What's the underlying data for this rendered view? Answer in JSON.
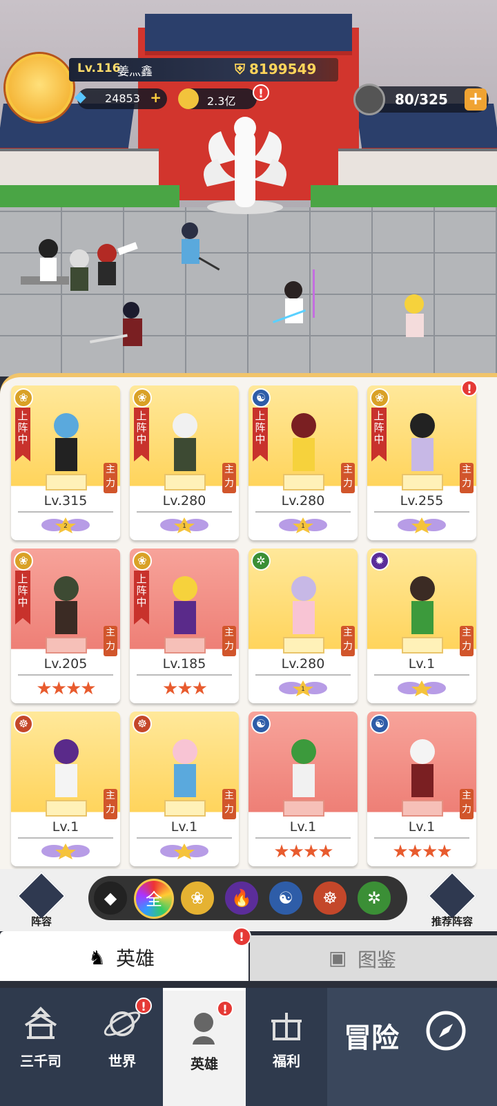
{
  "player": {
    "level": "Lv.116",
    "name": "姜灬鑫",
    "power": "8199549",
    "gems": "24853",
    "gold": "2.3亿",
    "stamina": "80/325"
  },
  "heroes": [
    {
      "level": "Lv.315",
      "status": "上阵中",
      "role": "主力",
      "style": "gold",
      "faction": "lotus",
      "rank": "2"
    },
    {
      "level": "Lv.280",
      "status": "上阵中",
      "role": "主力",
      "style": "gold",
      "faction": "lotus",
      "rank": "1"
    },
    {
      "level": "Lv.280",
      "status": "上阵中",
      "role": "主力",
      "style": "gold",
      "faction": "swirl",
      "rank": "1"
    },
    {
      "level": "Lv.255",
      "status": "上阵中",
      "role": "主力",
      "style": "gold",
      "faction": "lotus",
      "rank": ""
    },
    {
      "level": "Lv.205",
      "status": "上阵中",
      "role": "主力",
      "style": "red",
      "faction": "lotus",
      "stars": "★★★★"
    },
    {
      "level": "Lv.185",
      "status": "上阵中",
      "role": "主力",
      "style": "red",
      "faction": "lotus",
      "stars": "★★★"
    },
    {
      "level": "Lv.280",
      "status": "",
      "role": "主力",
      "style": "gold",
      "faction": "dna",
      "rank": "1"
    },
    {
      "level": "Lv.1",
      "status": "",
      "role": "主力",
      "style": "gold",
      "faction": "flame",
      "rank": ""
    },
    {
      "level": "Lv.1",
      "status": "",
      "role": "主力",
      "style": "gold",
      "faction": "meditate",
      "rank": ""
    },
    {
      "level": "Lv.1",
      "status": "",
      "role": "主力",
      "style": "gold",
      "faction": "meditate",
      "rank": ""
    },
    {
      "level": "Lv.1",
      "status": "",
      "role": "",
      "style": "red",
      "faction": "swirl",
      "stars": "★★★★"
    },
    {
      "level": "Lv.1",
      "status": "",
      "role": "主力",
      "style": "red",
      "faction": "swirl",
      "stars": "★★★★"
    }
  ],
  "filters": {
    "lineup": "阵容",
    "all": "全",
    "recommend": "推荐阵容"
  },
  "tabs": {
    "heroes": "英雄",
    "codex": "图鉴"
  },
  "nav": {
    "sanqian": "三千司",
    "world": "世界",
    "heroes": "英雄",
    "welfare": "福利",
    "adventure": "冒险"
  },
  "badge": "!"
}
